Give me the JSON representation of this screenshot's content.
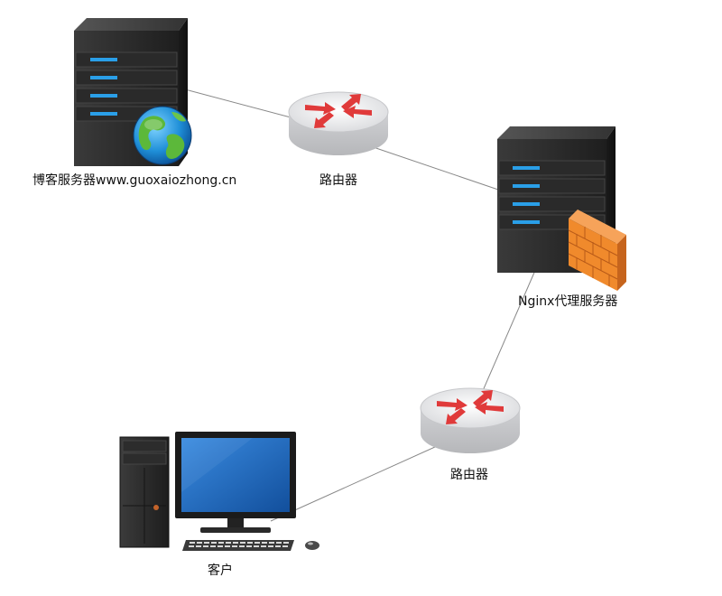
{
  "nodes": {
    "blog_server": {
      "label": "博客服务器www.guoxaiozhong.cn",
      "icon": "server-globe-icon"
    },
    "router_top": {
      "label": "路由器",
      "icon": "router-icon"
    },
    "nginx_proxy": {
      "label": "Nginx代理服务器",
      "icon": "server-firewall-icon"
    },
    "router_bottom": {
      "label": "路由器",
      "icon": "router-icon"
    },
    "client": {
      "label": "客户",
      "icon": "desktop-computer-icon"
    }
  },
  "colors": {
    "server_body": "#2b2b2b",
    "server_led": "#2a9fe8",
    "router_arrow": "#e03a3a",
    "firewall": "#f08a2c",
    "monitor_screen": "#1f6fc2",
    "connector": "#777777"
  }
}
